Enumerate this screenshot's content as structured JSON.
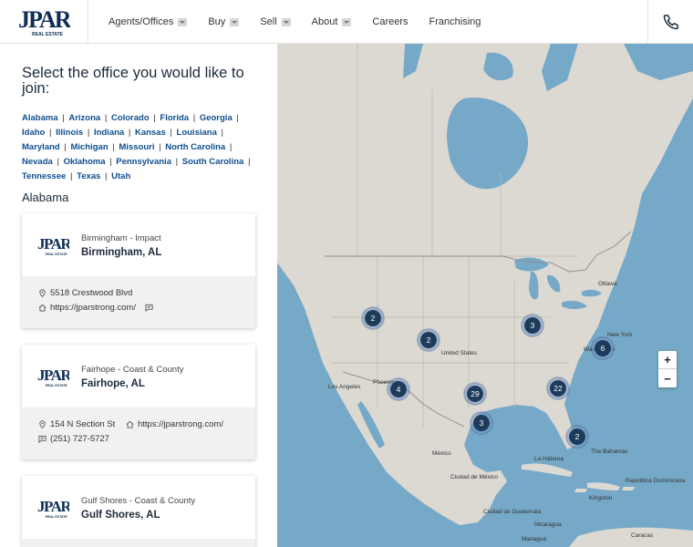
{
  "brand": {
    "logo_text": "JPAR",
    "logo_sub": "REAL ESTATE",
    "navy": "#0f2d57"
  },
  "nav": {
    "items": [
      {
        "label": "Agents/Offices",
        "dropdown": true
      },
      {
        "label": "Buy",
        "dropdown": true
      },
      {
        "label": "Sell",
        "dropdown": true
      },
      {
        "label": "About",
        "dropdown": true
      },
      {
        "label": "Careers",
        "dropdown": false
      },
      {
        "label": "Franchising",
        "dropdown": false
      }
    ],
    "phone_icon": "phone-icon"
  },
  "page": {
    "heading": "Select the office you would like to join:",
    "states": [
      "Alabama",
      "Arizona",
      "Colorado",
      "Florida",
      "Georgia",
      "Idaho",
      "Illinois",
      "Indiana",
      "Kansas",
      "Louisiana",
      "Maryland",
      "Michigan",
      "Missouri",
      "North Carolina",
      "Nevada",
      "Oklahoma",
      "Pennsylvania",
      "South Carolina",
      "Tennessee",
      "Texas",
      "Utah"
    ],
    "section_title": "Alabama"
  },
  "offices": [
    {
      "name": "Birmingham - Impact",
      "city": "Birmingham, AL",
      "address": "5518 Crestwood Blvd",
      "website": "https://jparstrong.com/",
      "phone": ""
    },
    {
      "name": "Fairhope - Coast & County",
      "city": "Fairhope, AL",
      "address": "154 N Section St",
      "website": "https://jparstrong.com/",
      "phone": "(251) 727-5727"
    },
    {
      "name": "Gulf Shores - Coast & County",
      "city": "Gulf Shores, AL"
    }
  ],
  "map": {
    "clusters": [
      "2",
      "2",
      "3",
      "6",
      "4",
      "29",
      "22",
      "3",
      "2"
    ],
    "zoom_in": "+",
    "zoom_out": "−",
    "labels": {
      "ottawa": "Ottawa",
      "new_york": "New York",
      "washington": "Washington",
      "united_states": "United States",
      "phoenix": "Phoenix",
      "los_angeles": "Los Angeles",
      "mexico": "México",
      "ciudad_de_mexico": "Ciudad de México",
      "la_habana": "La Habana",
      "the_bahamas": "The Bahamas",
      "republica_dominicana": "República Dominicana",
      "kingston": "Kingston",
      "ciudad_de_guatemala": "Ciudad de Guatemala",
      "nicaragua": "Nicaragua",
      "managua": "Managua",
      "caracas": "Caracas"
    },
    "colors": {
      "water": "#76a9c7",
      "land": "#dcd9d3",
      "cluster": "#1d3b5a"
    }
  }
}
